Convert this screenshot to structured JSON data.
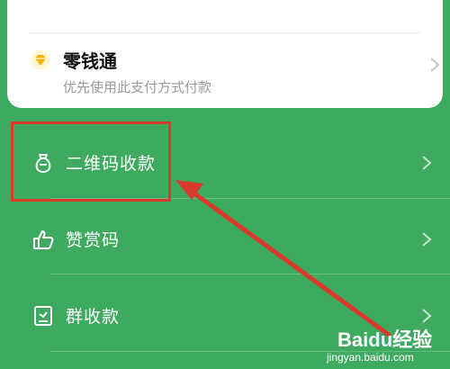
{
  "payment_card": {
    "title": "零钱通",
    "subtitle": "优先使用此支付方式付款",
    "icon": "diamond-icon"
  },
  "menu": {
    "items": [
      {
        "label": "二维码收款",
        "icon": "money-bag-icon"
      },
      {
        "label": "赞赏码",
        "icon": "thumbs-up-icon"
      },
      {
        "label": "群收款",
        "icon": "receipt-icon"
      }
    ]
  },
  "watermark": {
    "logo": "Bai",
    "logo_mark": "du",
    "logo_suffix": "经验",
    "url": "jingyan.baidu.com"
  },
  "colors": {
    "background": "#3daa5f",
    "highlight": "#d93a2b",
    "diamond": "#f2b400"
  }
}
